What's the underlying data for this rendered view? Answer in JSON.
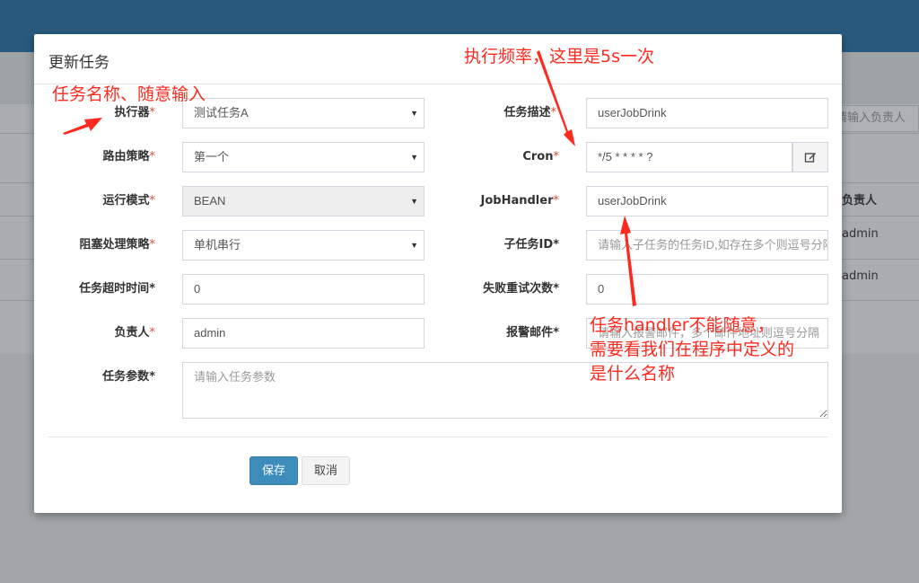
{
  "background": {
    "search_placeholder": "请输入负责人",
    "table_header": "负责人",
    "rows": [
      "admin",
      "admin"
    ]
  },
  "modal": {
    "title": "更新任务",
    "required_mark": "*",
    "fields": {
      "executor": {
        "label": "执行器",
        "value": "测试任务A"
      },
      "job_desc": {
        "label": "任务描述",
        "value": "userJobDrink"
      },
      "route_strategy": {
        "label": "路由策略",
        "value": "第一个"
      },
      "cron": {
        "label": "Cron",
        "value": "*/5 * * * * ?"
      },
      "run_mode": {
        "label": "运行模式",
        "value": "BEAN"
      },
      "job_handler": {
        "label": "JobHandler",
        "value": "userJobDrink"
      },
      "block_strategy": {
        "label": "阻塞处理策略",
        "value": "单机串行"
      },
      "child_job_id": {
        "label": "子任务ID",
        "placeholder": "请输入子任务的任务ID,如存在多个则逗号分隔"
      },
      "timeout": {
        "label": "任务超时时间",
        "value": "0"
      },
      "fail_retry": {
        "label": "失败重试次数",
        "value": "0"
      },
      "author": {
        "label": "负责人",
        "value": "admin"
      },
      "alarm_email": {
        "label": "报警邮件",
        "placeholder": "请输入报警邮件，多个邮件地址则逗号分隔"
      },
      "job_param": {
        "label": "任务参数",
        "placeholder": "请输入任务参数"
      }
    },
    "buttons": {
      "save": "保存",
      "cancel": "取消"
    }
  },
  "annotations": {
    "task_name": "任务名称、随意输入",
    "frequency": "执行频率，这里是5s一次",
    "handler_line1": "任务handler不能随意，",
    "handler_line2": "需要看我们在程序中定义的",
    "handler_line3": "是什么名称",
    "color": "#ff2a1f"
  },
  "colors": {
    "header": "#295a7d",
    "primary_button": "#3c8dbc",
    "required": "#dd4b39"
  }
}
